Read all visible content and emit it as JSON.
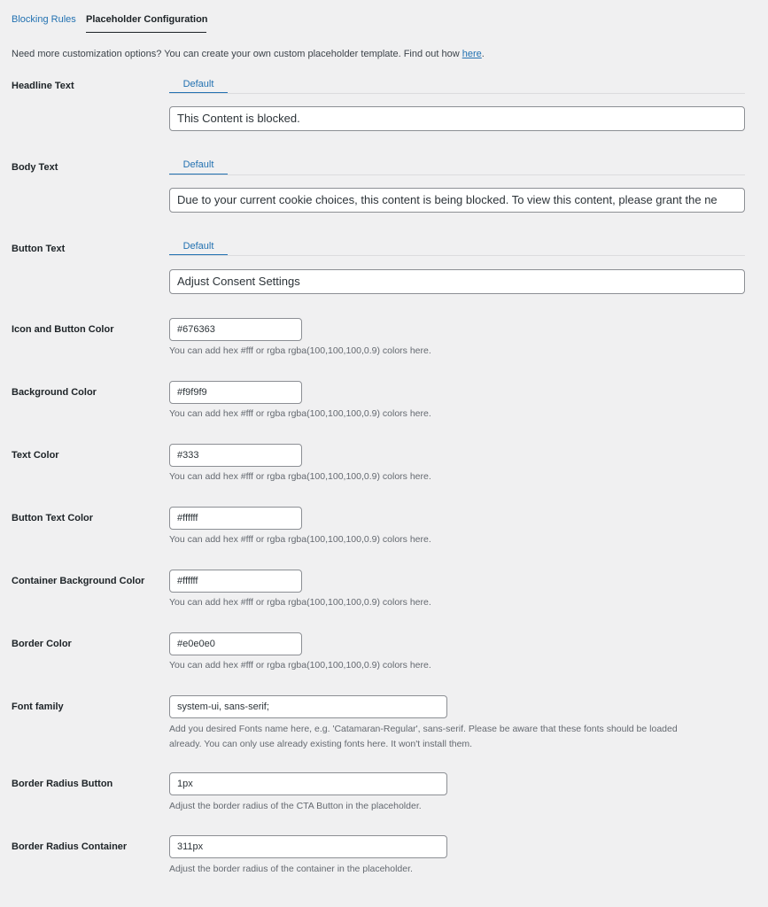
{
  "tabs": {
    "blocking_rules": "Blocking Rules",
    "placeholder_config": "Placeholder Configuration"
  },
  "intro": {
    "text": "Need more customization options? You can create your own custom placeholder template. Find out how ",
    "link": "here",
    "suffix": "."
  },
  "headline": {
    "label": "Headline Text",
    "tab": "Default",
    "value": "This Content is blocked."
  },
  "body_text": {
    "label": "Body Text",
    "tab": "Default",
    "value": "Due to your current cookie choices, this content is being blocked. To view this content, please grant the ne"
  },
  "button_text": {
    "label": "Button Text",
    "tab": "Default",
    "value": "Adjust Consent Settings"
  },
  "color_help": "You can add hex #fff or rgba rgba(100,100,100,0.9) colors here.",
  "icon_button_color": {
    "label": "Icon and Button Color",
    "value": "#676363"
  },
  "background_color": {
    "label": "Background Color",
    "value": "#f9f9f9"
  },
  "text_color": {
    "label": "Text Color",
    "value": "#333"
  },
  "button_text_color": {
    "label": "Button Text Color",
    "value": "#ffffff"
  },
  "container_bg_color": {
    "label": "Container Background Color",
    "value": "#ffffff"
  },
  "border_color": {
    "label": "Border Color",
    "value": "#e0e0e0"
  },
  "font_family": {
    "label": "Font family",
    "value": "system-ui, sans-serif;",
    "help_line1": "Add you desired Fonts name here, e.g. 'Catamaran-Regular', sans-serif. Please be aware that these fonts should be loaded",
    "help_line2": "already. You can only use already existing fonts here. It won't install them."
  },
  "border_radius_button": {
    "label": "Border Radius Button",
    "value": "1px",
    "help": "Adjust the border radius of the CTA Button in the placeholder."
  },
  "border_radius_container": {
    "label": "Border Radius Container",
    "value": "311px",
    "help": "Adjust the border radius of the container in the placeholder."
  },
  "colors": {
    "page_bg": "#f0f0f1",
    "link": "#2271b1",
    "input_border": "#8c8f94",
    "help_text": "#646970"
  }
}
